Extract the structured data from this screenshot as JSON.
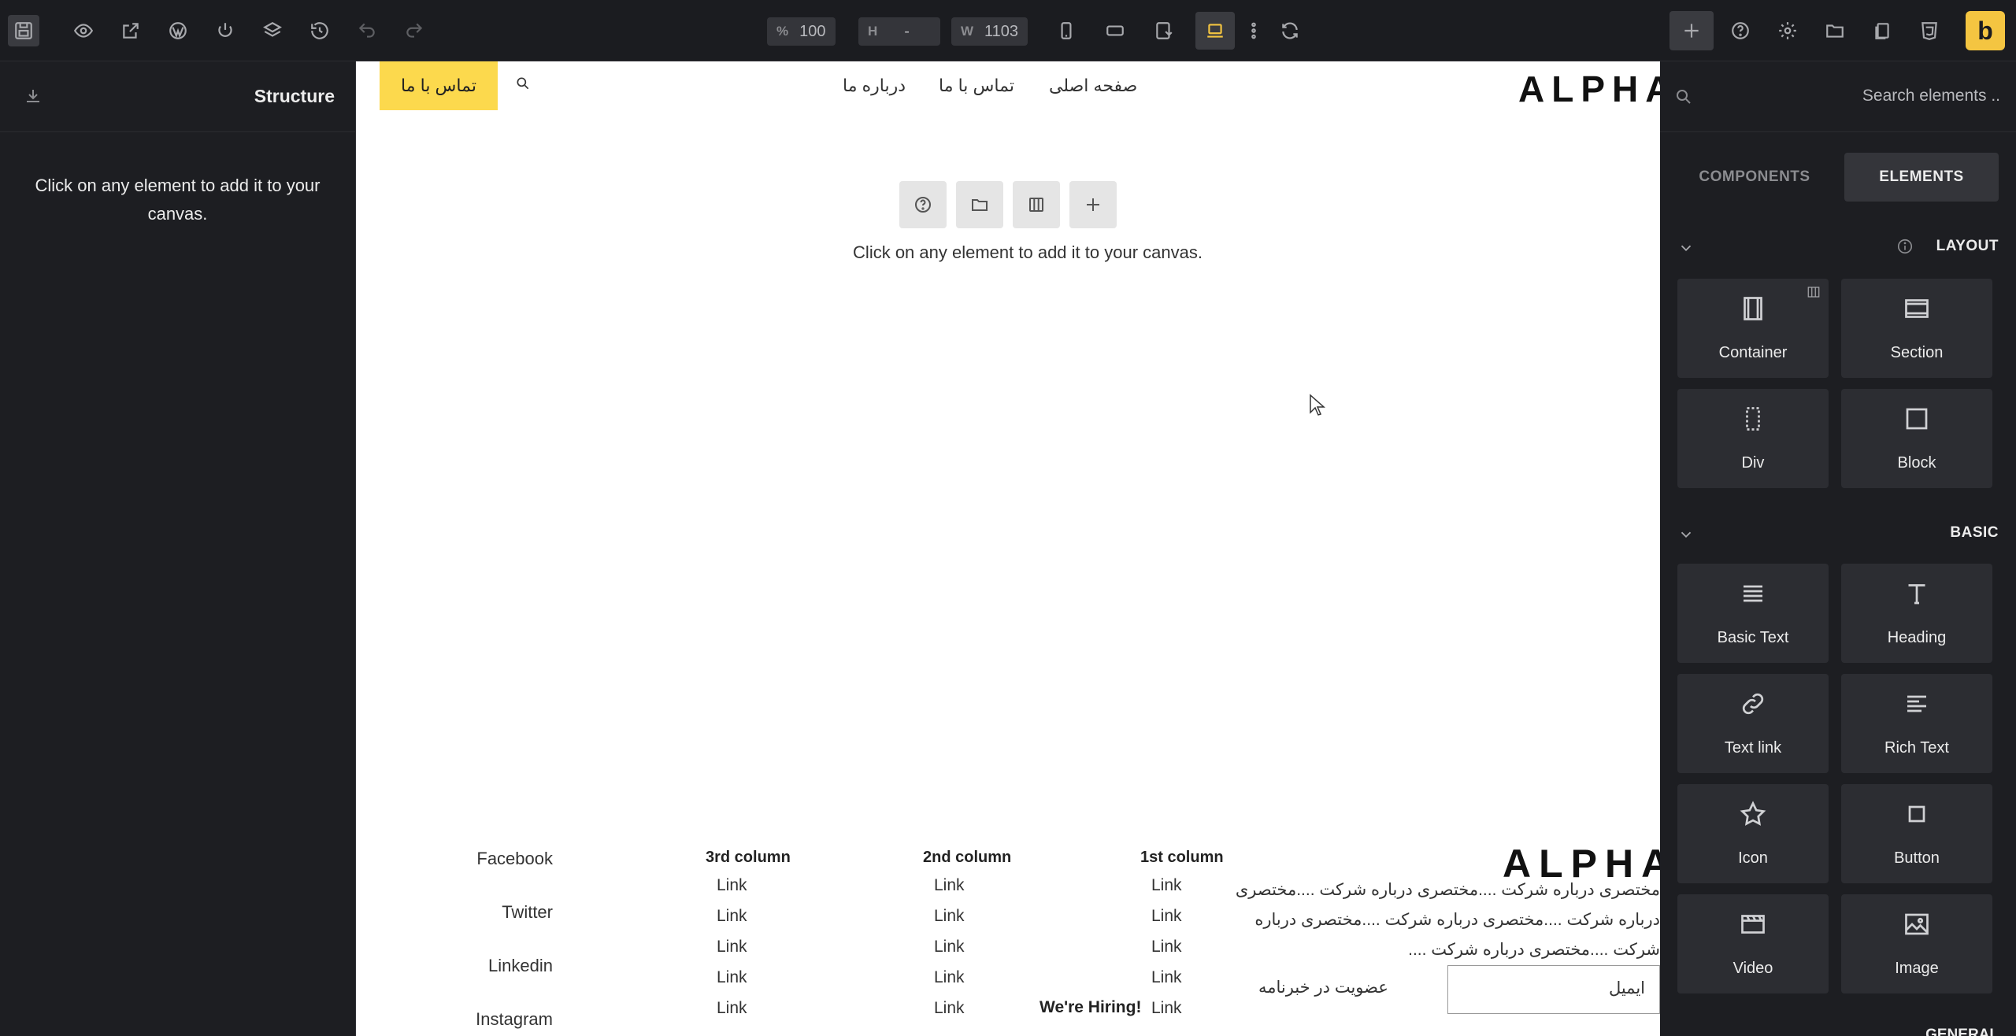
{
  "toolbar": {
    "zoom": {
      "key": "%",
      "value": "100"
    },
    "height": {
      "key": "H",
      "value": "-"
    },
    "width": {
      "key": "W",
      "value": "1103"
    },
    "brand": "b"
  },
  "left_panel": {
    "title": "Structure",
    "hint": "Click on any element to add it to your canvas."
  },
  "canvas": {
    "logo": "ALPHA",
    "nav": [
      "صفحه اصلی",
      "تماس با ما",
      "درباره ما"
    ],
    "cta": "تماس با ما",
    "empty_hint": "Click on any element to add it to your canvas.",
    "footer": {
      "logo": "ALPHA",
      "about": "مختصری درباره شرکت ....مختصری درباره شرکت ....مختصری درباره شرکت ....مختصری درباره شرکت ....مختصری درباره شرکت ....مختصری درباره شرکت ....",
      "columns": [
        {
          "title": "1st column",
          "links": [
            "Link",
            "Link",
            "Link",
            "Link",
            "Link"
          ]
        },
        {
          "title": "2nd column",
          "links": [
            "Link",
            "Link",
            "Link",
            "Link",
            "Link"
          ]
        },
        {
          "title": "3rd column",
          "links": [
            "Link",
            "Link",
            "Link",
            "Link",
            "Link"
          ]
        }
      ],
      "social": [
        "Facebook",
        "Twitter",
        "Linkedin",
        "Instagram"
      ],
      "hiring": "We're Hiring!",
      "newsletter_label": "عضویت در خبرنامه",
      "email_placeholder": "ایمیل"
    }
  },
  "right_panel": {
    "search_placeholder": "Search elements ..",
    "tabs": [
      "COMPONENTS",
      "ELEMENTS"
    ],
    "active_tab": "ELEMENTS",
    "layout_title": "LAYOUT",
    "layout_items": [
      {
        "label": "Container",
        "icon": "container-icon"
      },
      {
        "label": "Section",
        "icon": "section-icon"
      },
      {
        "label": "Div",
        "icon": "div-icon"
      },
      {
        "label": "Block",
        "icon": "block-icon"
      }
    ],
    "basic_title": "BASIC",
    "basic_items": [
      {
        "label": "Basic Text",
        "icon": "text-lines-icon"
      },
      {
        "label": "Heading",
        "icon": "heading-icon"
      },
      {
        "label": "Text link",
        "icon": "link-icon"
      },
      {
        "label": "Rich Text",
        "icon": "rich-text-icon"
      },
      {
        "label": "Icon",
        "icon": "star-icon"
      },
      {
        "label": "Button",
        "icon": "button-icon"
      },
      {
        "label": "Video",
        "icon": "video-icon"
      },
      {
        "label": "Image",
        "icon": "image-icon"
      }
    ],
    "general_title": "GENERAL"
  },
  "colors": {
    "accent": "#f4c541",
    "cta_bg": "#fcd94d",
    "panel_bg": "#1d1e22",
    "card_bg": "#2c2d32"
  }
}
